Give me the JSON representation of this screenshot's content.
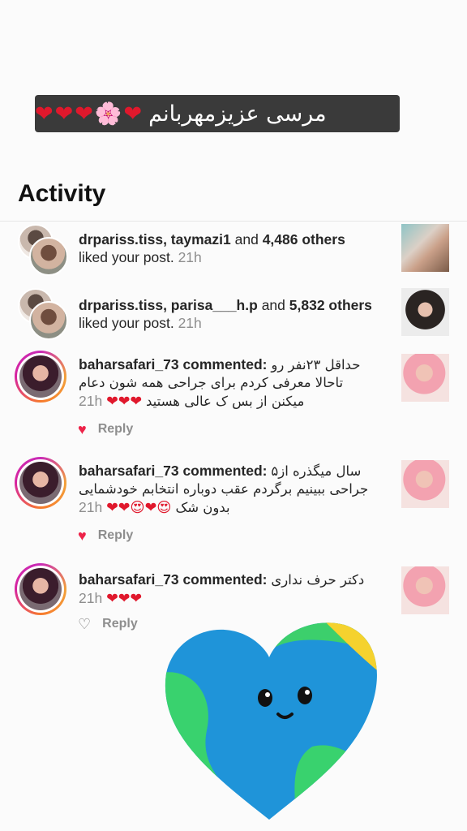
{
  "story_caption": {
    "text": "مرسی عزیزمهربانم",
    "emoji": [
      "❤",
      "🌸",
      "❤",
      "❤",
      "❤"
    ]
  },
  "activity": {
    "title": "Activity",
    "notifications": [
      {
        "type": "like",
        "users": "drpariss.tiss, taymazi1",
        "connector": "and",
        "count": "4,486 others",
        "action": "liked your post.",
        "time": "21h",
        "thumb": "woman-portrait-teal"
      },
      {
        "type": "like",
        "users": "drpariss.tiss, parisa___h.p",
        "connector": "and",
        "count": "5,832 others",
        "action": "liked your post.",
        "time": "21h",
        "thumb": "woman-portrait-dark"
      },
      {
        "type": "comment",
        "user": "baharsafari_73",
        "verb": "commented:",
        "line1": "حداقل ۲۳نفر رو",
        "line2": "تاحالا معرفی کردم برای جراحی همه شون دعام",
        "line3": "میکنن از بس ک عالی هستید",
        "line3_emoji": "❤❤❤",
        "time": "21h",
        "liked": true,
        "reply": "Reply"
      },
      {
        "type": "comment",
        "user": "baharsafari_73",
        "verb": "commented:",
        "line1": "سال میگذره از۵",
        "line2": "جراحی ببینیم برگردم عقب دوباره انتخابم خودشمایی",
        "line3": "بدون شک",
        "line3_emoji": "❤❤😍❤😍",
        "time": "21h",
        "liked": true,
        "reply": "Reply"
      },
      {
        "type": "comment",
        "user": "baharsafari_73",
        "verb": "commented:",
        "line1": "دکتر حرف نداری",
        "line3_emoji": "❤❤❤",
        "time": "21h",
        "liked": false,
        "reply": "Reply"
      }
    ]
  },
  "sticker": {
    "name": "smiling-earth-heart-sticker"
  }
}
